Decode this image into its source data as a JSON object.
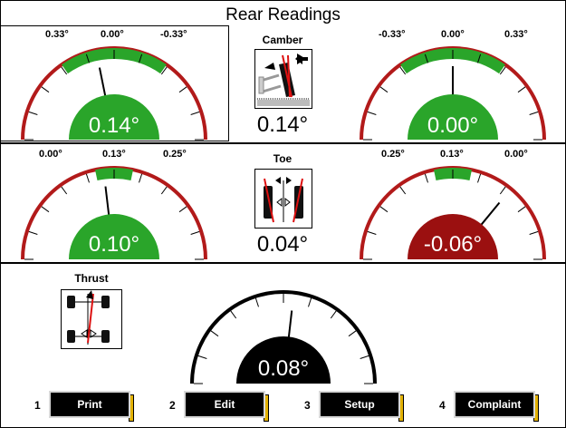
{
  "title": "Rear Readings",
  "colors": {
    "good": "#2aa52a",
    "bad": "#9b1010",
    "neutral": "#000000",
    "arc": "#b21a1a",
    "band": "#2aa52a",
    "button_edge": "#e2b100"
  },
  "camber": {
    "label": "Camber",
    "icon": "camber-wheel-icon",
    "total": "0.14°",
    "left": {
      "ticks": [
        "0.33°",
        "0.00°",
        "-0.33°"
      ],
      "value": "0.14°",
      "needle_deg": 0.14,
      "status": "good"
    },
    "right": {
      "ticks": [
        "-0.33°",
        "0.00°",
        "0.33°"
      ],
      "value": "0.00°",
      "needle_deg": 0.0,
      "status": "good"
    }
  },
  "toe": {
    "label": "Toe",
    "icon": "toe-wheels-icon",
    "total": "0.04°",
    "left": {
      "ticks": [
        "0.00°",
        "0.13°",
        "0.25°"
      ],
      "value": "0.10°",
      "needle_deg": 0.1,
      "status": "good"
    },
    "right": {
      "ticks": [
        "0.25°",
        "0.13°",
        "0.00°"
      ],
      "value": "-0.06°",
      "needle_deg": -0.06,
      "status": "bad"
    }
  },
  "thrust": {
    "label": "Thrust",
    "icon": "thrust-vehicle-icon",
    "value": "0.08°",
    "needle_deg": 0.08
  },
  "buttons": [
    {
      "num": "1",
      "label": "Print"
    },
    {
      "num": "2",
      "label": "Edit"
    },
    {
      "num": "3",
      "label": "Setup"
    },
    {
      "num": "4",
      "label": "Complaint"
    }
  ]
}
